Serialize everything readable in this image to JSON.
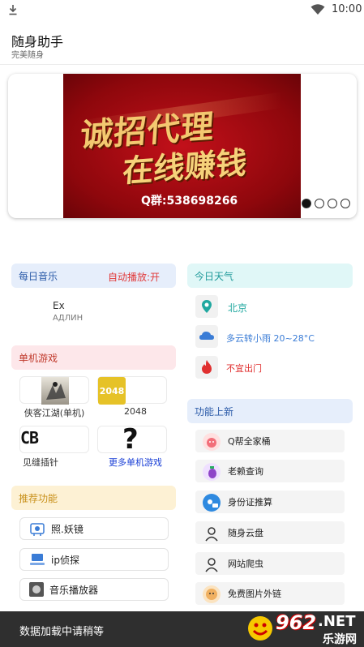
{
  "status_bar": {
    "time": "10:00"
  },
  "app": {
    "title": "随身助手",
    "subtitle": "完美随身"
  },
  "banner": {
    "line1": "诚招代理",
    "line2": "在线赚钱",
    "qq": "Q群:538698266",
    "page_count": 4,
    "active_index": 0
  },
  "music": {
    "title": "每日音乐",
    "autoplay": "自动播放:开",
    "song": "Ex",
    "artist": "АДЛИН"
  },
  "games": {
    "title": "单机游戏",
    "items": [
      {
        "label": "侠客江湖(单机)",
        "icon": "ink-warrior-icon"
      },
      {
        "label": "2048",
        "icon_text": "2048"
      },
      {
        "label": "见缝插针",
        "icon_text": "CB"
      },
      {
        "label": "更多单机游戏",
        "icon_text": "?"
      }
    ],
    "link_color": "#1a3fd6"
  },
  "recommend": {
    "title": "推荐功能",
    "items": [
      {
        "label": "照.妖镜"
      },
      {
        "label": "ip侦探"
      },
      {
        "label": "音乐播放器"
      }
    ]
  },
  "weather": {
    "title": "今日天气",
    "items": [
      {
        "text": "北京",
        "icon": "location-pin-icon"
      },
      {
        "text": "多云转小雨 20~28°C",
        "icon": "cloud-icon"
      },
      {
        "text": "不宜出门",
        "icon": "fire-icon"
      }
    ],
    "colors": {
      "location": "#20a8a0",
      "cloud": "#3a7cd6",
      "warn": "#e03030"
    }
  },
  "updates": {
    "title": "功能上新",
    "items": [
      {
        "label": "Q帮全家桶"
      },
      {
        "label": "老赖查询"
      },
      {
        "label": "身份证推算"
      },
      {
        "label": "随身云盘"
      },
      {
        "label": "网站爬虫"
      },
      {
        "label": "免费图片外链"
      }
    ]
  },
  "toast": {
    "text": "数据加载中请稍等"
  },
  "watermark": {
    "number": "962",
    "tld": ".NET",
    "cn": "乐游网"
  }
}
